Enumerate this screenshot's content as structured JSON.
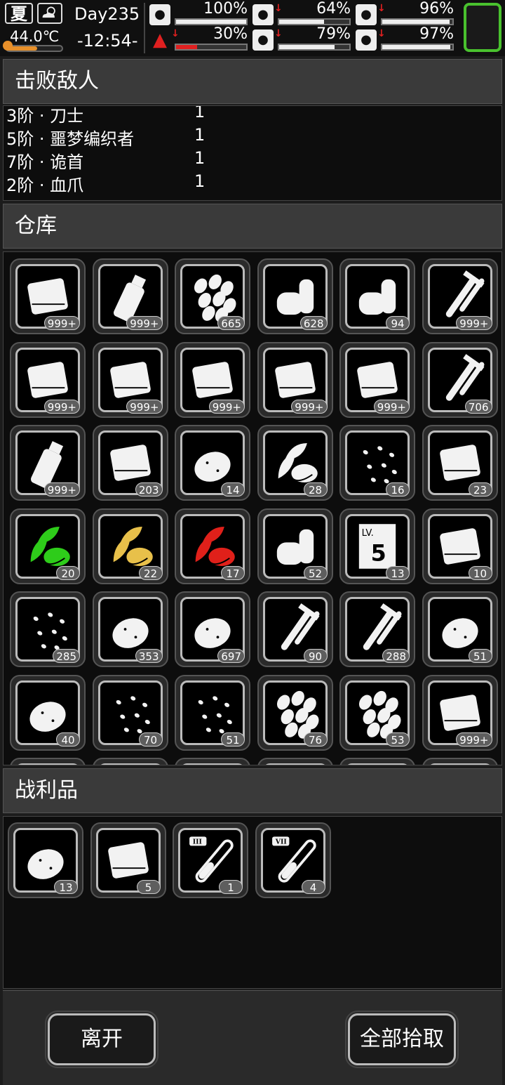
{
  "status": {
    "season": "夏",
    "weather_icon": "partly-cloudy-icon",
    "temperature": "44.0℃",
    "day": "Day235",
    "time": "-12:54-",
    "stats": [
      {
        "name": "health",
        "icon": "medkit-icon",
        "value": "100%",
        "level": 1.0,
        "down": false
      },
      {
        "name": "hunger",
        "icon": "stomach-icon",
        "value": "64%",
        "level": 0.64,
        "down": true
      },
      {
        "name": "mood",
        "icon": "pill-icon",
        "value": "96%",
        "level": 0.96,
        "down": true
      },
      {
        "name": "stamina",
        "icon": "boot-icon",
        "value": "30%",
        "level": 0.3,
        "down": true
      },
      {
        "name": "thirst",
        "icon": "water-drop-icon",
        "value": "79%",
        "level": 0.79,
        "down": true
      },
      {
        "name": "spirit",
        "icon": "heart-icon",
        "value": "97%",
        "level": 0.97,
        "down": true
      }
    ]
  },
  "defeated": {
    "title": "击败敌人",
    "enemies": [
      {
        "name": "3阶 · 刀士",
        "count": "1"
      },
      {
        "name": "5阶 · 噩梦编织者",
        "count": "1"
      },
      {
        "name": "7阶 · 诡首",
        "count": "1"
      },
      {
        "name": "2阶 · 血爪",
        "count": "1"
      }
    ]
  },
  "storage": {
    "title": "仓库",
    "items": [
      {
        "icon": "cloth-scraps-icon",
        "qty": "999+"
      },
      {
        "icon": "plastic-bottle-icon",
        "qty": "999+"
      },
      {
        "icon": "bullets-icon",
        "qty": "665"
      },
      {
        "icon": "cans-icon",
        "qty": "628"
      },
      {
        "icon": "batteries-icon",
        "qty": "94"
      },
      {
        "icon": "nails-icon",
        "qty": "999+"
      },
      {
        "icon": "paper-icon",
        "qty": "999+"
      },
      {
        "icon": "fabric-pile-icon",
        "qty": "999+"
      },
      {
        "icon": "cotton-icon",
        "qty": "999+"
      },
      {
        "icon": "leather-roll-icon",
        "qty": "999+"
      },
      {
        "icon": "cloth-sheet-icon",
        "qty": "999+"
      },
      {
        "icon": "leek-icon",
        "qty": "706"
      },
      {
        "icon": "milk-bottle-icon",
        "qty": "999+"
      },
      {
        "icon": "cookies-tray-icon",
        "qty": "203"
      },
      {
        "icon": "lemon-icon",
        "qty": "14"
      },
      {
        "icon": "herb-bundle-icon",
        "qty": "28"
      },
      {
        "icon": "seeds-icon",
        "qty": "16"
      },
      {
        "icon": "ginger-icon",
        "qty": "23"
      },
      {
        "icon": "green-herb-icon",
        "qty": "20",
        "color": "#2ecc1a"
      },
      {
        "icon": "yellow-herb-icon",
        "qty": "22",
        "color": "#e8c04a"
      },
      {
        "icon": "red-herb-icon",
        "qty": "17",
        "color": "#e0201a"
      },
      {
        "icon": "rope-icon",
        "qty": "52"
      },
      {
        "icon": "skill-book-icon",
        "qty": "13",
        "label": "LV.",
        "big": "5"
      },
      {
        "icon": "food-box-icon",
        "qty": "10"
      },
      {
        "icon": "rice-bucket-icon",
        "qty": "285"
      },
      {
        "icon": "potato-icon",
        "qty": "353"
      },
      {
        "icon": "meat-icon",
        "qty": "697"
      },
      {
        "icon": "corn-icon",
        "qty": "90"
      },
      {
        "icon": "carrot-icon",
        "qty": "288"
      },
      {
        "icon": "egg-icon",
        "qty": "51"
      },
      {
        "icon": "tomato-sprout-icon",
        "qty": "40"
      },
      {
        "icon": "rice-grains-icon",
        "qty": "70"
      },
      {
        "icon": "sunflower-seeds-icon",
        "qty": "51"
      },
      {
        "icon": "beans-icon",
        "qty": "76"
      },
      {
        "icon": "almonds-icon",
        "qty": "53"
      },
      {
        "icon": "bacon-icon",
        "qty": "999+"
      }
    ]
  },
  "loot": {
    "title": "战利品",
    "items": [
      {
        "icon": "sweet-potato-icon",
        "qty": "13"
      },
      {
        "icon": "fabric-pile-icon",
        "qty": "5"
      },
      {
        "icon": "test-tube-iii-icon",
        "qty": "1",
        "tier": "III"
      },
      {
        "icon": "test-tube-vii-icon",
        "qty": "4",
        "tier": "VII"
      }
    ]
  },
  "buttons": {
    "leave": "离开",
    "take_all": "全部拾取"
  }
}
